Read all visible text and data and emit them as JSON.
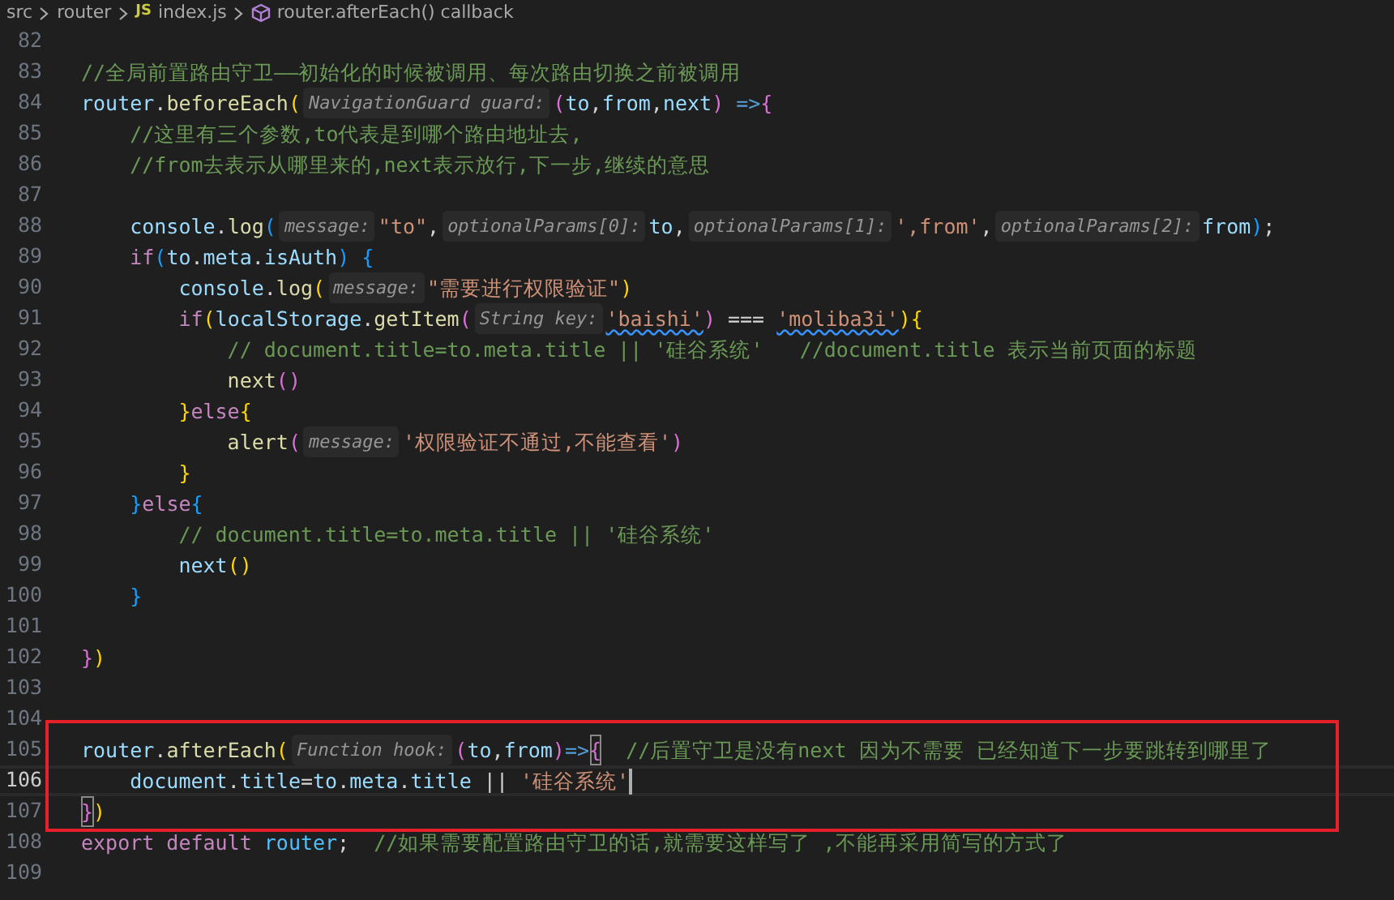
{
  "breadcrumb": [
    {
      "kind": "folder",
      "text": "src"
    },
    {
      "kind": "folder",
      "text": "router"
    },
    {
      "kind": "file",
      "badge": "JS",
      "text": "index.js"
    },
    {
      "kind": "symbol",
      "text": "router.afterEach() callback"
    }
  ],
  "lines": [
    {
      "number": "82",
      "current": false,
      "boxed": false
    },
    {
      "number": "83",
      "current": false,
      "boxed": false,
      "tokens": [
        {
          "kind": "cmt",
          "text": "//全局前置路由守卫——初始化的时候被调用、每次路由切换之前被调用"
        }
      ]
    },
    {
      "number": "84",
      "current": false,
      "boxed": false,
      "tokens": [
        {
          "kind": "var",
          "text": "router"
        },
        {
          "kind": "punct",
          "text": "."
        },
        {
          "kind": "fn",
          "text": "beforeEach"
        },
        {
          "kind": "b1",
          "text": "("
        },
        {
          "kind": "hint",
          "text": "NavigationGuard guard:"
        },
        {
          "kind": "b2",
          "text": "("
        },
        {
          "kind": "var",
          "text": "to"
        },
        {
          "kind": "punct",
          "text": ","
        },
        {
          "kind": "var",
          "text": "from"
        },
        {
          "kind": "punct",
          "text": ","
        },
        {
          "kind": "var",
          "text": "next"
        },
        {
          "kind": "b2",
          "text": ")"
        },
        {
          "kind": "op",
          "text": " =>"
        },
        {
          "kind": "b2",
          "text": "{"
        }
      ]
    },
    {
      "number": "85",
      "current": false,
      "boxed": false,
      "tokens": [
        {
          "kind": "cmt",
          "text": "    //这里有三个参数,to代表是到哪个路由地址去,"
        }
      ]
    },
    {
      "number": "86",
      "current": false,
      "boxed": false,
      "tokens": [
        {
          "kind": "cmt",
          "text": "    //from去表示从哪里来的,next表示放行,下一步,继续的意思"
        }
      ]
    },
    {
      "number": "87",
      "current": false,
      "boxed": false
    },
    {
      "number": "88",
      "current": false,
      "boxed": false,
      "tokens": [
        {
          "kind": "var",
          "text": "    console"
        },
        {
          "kind": "punct",
          "text": "."
        },
        {
          "kind": "fn",
          "text": "log"
        },
        {
          "kind": "b3",
          "text": "("
        },
        {
          "kind": "hint",
          "text": "message:"
        },
        {
          "kind": "str",
          "text": "\"to\""
        },
        {
          "kind": "punct",
          "text": ","
        },
        {
          "kind": "hint",
          "text": "optionalParams[0]:"
        },
        {
          "kind": "var",
          "text": "to"
        },
        {
          "kind": "punct",
          "text": ","
        },
        {
          "kind": "hint",
          "text": "optionalParams[1]:"
        },
        {
          "kind": "str",
          "text": "',from'"
        },
        {
          "kind": "punct",
          "text": ","
        },
        {
          "kind": "hint",
          "text": "optionalParams[2]:"
        },
        {
          "kind": "var",
          "text": "from"
        },
        {
          "kind": "b3",
          "text": ")"
        },
        {
          "kind": "punct",
          "text": ";"
        }
      ]
    },
    {
      "number": "89",
      "current": false,
      "boxed": false,
      "tokens": [
        {
          "kind": "kw",
          "text": "    if"
        },
        {
          "kind": "b3",
          "text": "("
        },
        {
          "kind": "var",
          "text": "to"
        },
        {
          "kind": "punct",
          "text": "."
        },
        {
          "kind": "var",
          "text": "meta"
        },
        {
          "kind": "punct",
          "text": "."
        },
        {
          "kind": "var",
          "text": "isAuth"
        },
        {
          "kind": "b3",
          "text": ") "
        },
        {
          "kind": "b3",
          "text": "{"
        }
      ]
    },
    {
      "number": "90",
      "current": false,
      "boxed": false,
      "tokens": [
        {
          "kind": "var",
          "text": "        console"
        },
        {
          "kind": "punct",
          "text": "."
        },
        {
          "kind": "fn",
          "text": "log"
        },
        {
          "kind": "b1",
          "text": "("
        },
        {
          "kind": "hint",
          "text": "message:"
        },
        {
          "kind": "str",
          "text": "\"需要进行权限验证\""
        },
        {
          "kind": "b1",
          "text": ")"
        }
      ]
    },
    {
      "number": "91",
      "current": false,
      "boxed": false,
      "tokens": [
        {
          "kind": "kw",
          "text": "        if"
        },
        {
          "kind": "b1",
          "text": "("
        },
        {
          "kind": "var",
          "text": "localStorage"
        },
        {
          "kind": "punct",
          "text": "."
        },
        {
          "kind": "fn",
          "text": "getItem"
        },
        {
          "kind": "b2",
          "text": "("
        },
        {
          "kind": "hint",
          "text": "String key:"
        },
        {
          "kind": "str",
          "text": "'baishi'",
          "squiggle": true
        },
        {
          "kind": "b2",
          "text": ")"
        },
        {
          "kind": "punct",
          "text": " === "
        },
        {
          "kind": "str",
          "text": "'moliba3i'",
          "squiggle": true
        },
        {
          "kind": "b1",
          "text": ")"
        },
        {
          "kind": "b1",
          "text": "{"
        }
      ]
    },
    {
      "number": "92",
      "current": false,
      "boxed": false,
      "tokens": [
        {
          "kind": "cmt",
          "text": "            // document.title=to.meta.title || '硅谷系统'   //document.title 表示当前页面的标题"
        }
      ]
    },
    {
      "number": "93",
      "current": false,
      "boxed": false,
      "tokens": [
        {
          "kind": "fn",
          "text": "            next"
        },
        {
          "kind": "b2",
          "text": "()"
        }
      ]
    },
    {
      "number": "94",
      "current": false,
      "boxed": false,
      "tokens": [
        {
          "kind": "b1",
          "text": "        }"
        },
        {
          "kind": "kw",
          "text": "else"
        },
        {
          "kind": "b1",
          "text": "{"
        }
      ]
    },
    {
      "number": "95",
      "current": false,
      "boxed": false,
      "tokens": [
        {
          "kind": "fn",
          "text": "            alert"
        },
        {
          "kind": "b2",
          "text": "("
        },
        {
          "kind": "hint",
          "text": "message:"
        },
        {
          "kind": "str",
          "text": "'权限验证不通过,不能查看'"
        },
        {
          "kind": "b2",
          "text": ")"
        }
      ]
    },
    {
      "number": "96",
      "current": false,
      "boxed": false,
      "tokens": [
        {
          "kind": "b1",
          "text": "        }"
        }
      ]
    },
    {
      "number": "97",
      "current": false,
      "boxed": false,
      "tokens": [
        {
          "kind": "b3",
          "text": "    }"
        },
        {
          "kind": "kw",
          "text": "else"
        },
        {
          "kind": "b3",
          "text": "{"
        }
      ]
    },
    {
      "number": "98",
      "current": false,
      "boxed": false,
      "tokens": [
        {
          "kind": "cmt",
          "text": "        // document.title=to.meta.title || '硅谷系统'"
        }
      ]
    },
    {
      "number": "99",
      "current": false,
      "boxed": false,
      "tokens": [
        {
          "kind": "var",
          "text": "        next"
        },
        {
          "kind": "b1",
          "text": "()"
        }
      ]
    },
    {
      "number": "100",
      "current": false,
      "boxed": false,
      "tokens": [
        {
          "kind": "b3",
          "text": "    }"
        }
      ]
    },
    {
      "number": "101",
      "current": false,
      "boxed": false
    },
    {
      "number": "102",
      "current": false,
      "boxed": false,
      "tokens": [
        {
          "kind": "b2",
          "text": "}"
        },
        {
          "kind": "b1",
          "text": ")"
        }
      ]
    },
    {
      "number": "103",
      "current": false,
      "boxed": false
    },
    {
      "number": "104",
      "current": false,
      "boxed": true
    },
    {
      "number": "105",
      "current": false,
      "boxed": true,
      "tokens": [
        {
          "kind": "var",
          "text": "router"
        },
        {
          "kind": "punct",
          "text": "."
        },
        {
          "kind": "fn",
          "text": "afterEach"
        },
        {
          "kind": "b1",
          "text": "("
        },
        {
          "kind": "hint",
          "text": "Function hook:"
        },
        {
          "kind": "b2",
          "text": "("
        },
        {
          "kind": "var",
          "text": "to"
        },
        {
          "kind": "punct",
          "text": ","
        },
        {
          "kind": "var",
          "text": "from"
        },
        {
          "kind": "b2",
          "text": ")"
        },
        {
          "kind": "op",
          "text": "=>"
        },
        {
          "kind": "b2",
          "text": "{",
          "matched": true
        },
        {
          "kind": "cmt",
          "text": "  //后置守卫是没有next 因为不需要 已经知道下一步要跳转到哪里了"
        }
      ]
    },
    {
      "number": "106",
      "current": true,
      "boxed": true,
      "cursor": true,
      "tokens": [
        {
          "kind": "var",
          "text": "    document"
        },
        {
          "kind": "punct",
          "text": "."
        },
        {
          "kind": "var",
          "text": "title"
        },
        {
          "kind": "punct",
          "text": "="
        },
        {
          "kind": "var",
          "text": "to"
        },
        {
          "kind": "punct",
          "text": "."
        },
        {
          "kind": "var",
          "text": "meta"
        },
        {
          "kind": "punct",
          "text": "."
        },
        {
          "kind": "var",
          "text": "title"
        },
        {
          "kind": "punct",
          "text": " || "
        },
        {
          "kind": "str",
          "text": "'硅谷系统'"
        }
      ]
    },
    {
      "number": "107",
      "current": false,
      "boxed": true,
      "tokens": [
        {
          "kind": "b2",
          "text": "}",
          "matched": true
        },
        {
          "kind": "b1",
          "text": ")"
        }
      ]
    },
    {
      "number": "108",
      "current": false,
      "boxed": false,
      "tokens": [
        {
          "kind": "kw",
          "text": "export default "
        },
        {
          "kind": "var2",
          "text": "router"
        },
        {
          "kind": "punct",
          "text": ";"
        },
        {
          "kind": "cmt",
          "text": "  //如果需要配置路由守卫的话,就需要这样写了 ,不能再采用简写的方式了"
        }
      ]
    },
    {
      "number": "109",
      "current": false,
      "boxed": false
    }
  ]
}
